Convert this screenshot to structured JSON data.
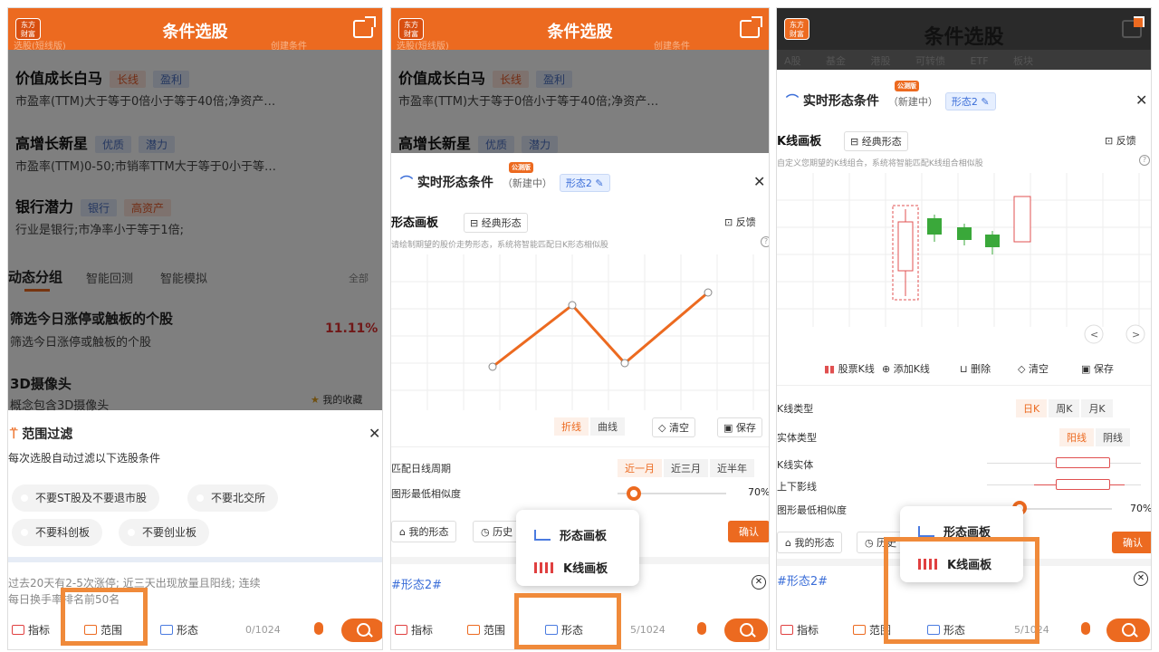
{
  "app": {
    "title": "条件选股",
    "logo": "东方\n财富"
  },
  "p1": {
    "ghost_left": "选股(短线版)",
    "ghost_right": "创建条件",
    "strategies": [
      {
        "title": "价值成长白马",
        "tags": [
          "长线",
          "盈利"
        ],
        "desc": "市盈率(TTM)大于等于0倍小于等于40倍;净资产…"
      },
      {
        "title": "高增长新星",
        "tags": [
          "优质",
          "潜力"
        ],
        "desc": "市盈率(TTM)0-50;市销率TTM大于等于0小于等…"
      },
      {
        "title": "银行潜力",
        "tags": [
          "银行",
          "高资产"
        ],
        "desc": "行业是银行;市净率小于等于1倍;"
      }
    ],
    "tabs": [
      "动态分组",
      "智能回测",
      "智能模拟"
    ],
    "tabs_more": "全部",
    "item1_title": "筛选今日涨停或触板的个股",
    "item1_desc": "筛选今日涨停或触板的个股",
    "item1_pct": "11.11%",
    "item2_title": "3D摄像头",
    "item2_desc": "概念包含3D摄像头",
    "fav": "我的收藏",
    "sheet": {
      "title": "范围过滤",
      "subtitle": "每次选股自动过滤以下选股条件",
      "chips": [
        "不要ST股及不要退市股",
        "不要北交所",
        "不要科创板",
        "不要创业板"
      ]
    },
    "query": "过去20天有2-5次涨停; 近三天出现放量且阳线; 连续",
    "query2": "每日换手率排名前50名",
    "bottom": {
      "indicator": "指标",
      "range": "范围",
      "pattern": "形态",
      "count": "0/1024"
    }
  },
  "p2": {
    "ghost_left": "选股(短线版)",
    "ghost_right": "创建条件",
    "strategies": [
      {
        "title": "价值成长白马",
        "tags": [
          "长线",
          "盈利"
        ],
        "desc": "市盈率(TTM)大于等于0倍小于等于40倍;净资产…"
      },
      {
        "title": "高增长新星",
        "tags": [
          "优质",
          "潜力"
        ]
      }
    ],
    "modal": {
      "title": "实时形态条件",
      "new_badge": "公测版",
      "status": "（新建中）",
      "pattern_name": "形态2",
      "section": "形态画板",
      "classic": "经典形态",
      "feedback": "反馈",
      "hint": "请绘制期望的股价走势形态，系统将智能匹配日K形态相似股",
      "draw_modes": [
        "折线",
        "曲线"
      ],
      "clear": "清空",
      "save": "保存",
      "period_label": "匹配日线周期",
      "periods": [
        "近一月",
        "近三月",
        "近半年"
      ],
      "sim_label": "图形最低相似度",
      "sim_value": "70%",
      "my_pattern": "我的形态",
      "history": "历史",
      "confirm": "确认"
    },
    "popup": [
      "形态画板",
      "K线画板"
    ],
    "hash": "#形态2#",
    "bottom": {
      "indicator": "指标",
      "range": "范围",
      "pattern": "形态",
      "count": "5/1024"
    }
  },
  "p3": {
    "ghost_tabs": [
      "A股",
      "基金",
      "港股",
      "可转债",
      "ETF",
      "板块"
    ],
    "modal": {
      "title": "实时形态条件",
      "new_badge": "公测版",
      "status": "（新建中）",
      "pattern_name": "形态2",
      "section": "K线画板",
      "classic": "经典形态",
      "feedback": "反馈",
      "hint": "自定义您期望的K线组合，系统将智能匹配K线组合相似股",
      "tools": [
        "股票K线",
        "添加K线",
        "删除",
        "清空",
        "保存"
      ],
      "kline_type_label": "K线类型",
      "kline_types": [
        "日K",
        "周K",
        "月K"
      ],
      "body_type_label": "实体类型",
      "body_types": [
        "阳线",
        "阴线"
      ],
      "body_label": "K线实体",
      "shadow_label": "上下影线",
      "sim_label": "图形最低相似度",
      "sim_value": "70%",
      "my_pattern": "我的形态",
      "history": "历史",
      "confirm": "确认"
    },
    "popup": [
      "形态画板",
      "K线画板"
    ],
    "hash": "#形态2#",
    "bottom": {
      "indicator": "指标",
      "range": "范围",
      "pattern": "形态",
      "count": "5/1024"
    }
  },
  "colors": {
    "accent": "#ec6a20",
    "highlight": "#f08a3a",
    "link": "#3b6ed8"
  }
}
